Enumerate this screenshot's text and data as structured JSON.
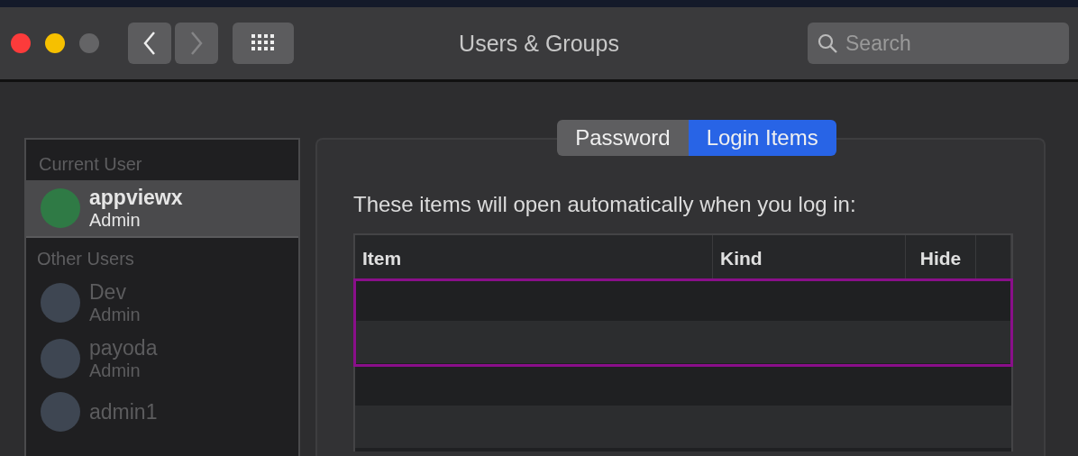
{
  "window": {
    "title": "Users & Groups",
    "controls": [
      {
        "kind": "close",
        "disabled": false
      },
      {
        "kind": "minimize",
        "disabled": false
      },
      {
        "kind": "zoom",
        "disabled": true
      }
    ]
  },
  "toolbar": {
    "back": {
      "disabled": false
    },
    "forward": {
      "disabled": true
    }
  },
  "search": {
    "placeholder": "Search"
  },
  "sidebar": {
    "sections": [
      {
        "heading": "Current User",
        "users": [
          {
            "name": "appviewx",
            "role": "Admin",
            "selected": true,
            "disabled": false
          }
        ]
      },
      {
        "heading": "Other Users",
        "users": [
          {
            "name": "Dev",
            "role": "Admin",
            "selected": false,
            "disabled": true
          },
          {
            "name": "payoda",
            "role": "Admin",
            "selected": false,
            "disabled": true
          },
          {
            "name": "admin1",
            "selected": false,
            "disabled": true
          }
        ]
      }
    ]
  },
  "tabs": [
    {
      "label": "Password",
      "selected": false
    },
    {
      "label": "Login Items",
      "selected": true
    }
  ],
  "intro": "These items will open automatically when you log in:",
  "table": {
    "columns": [
      "Item",
      "Kind",
      "Hide"
    ]
  }
}
